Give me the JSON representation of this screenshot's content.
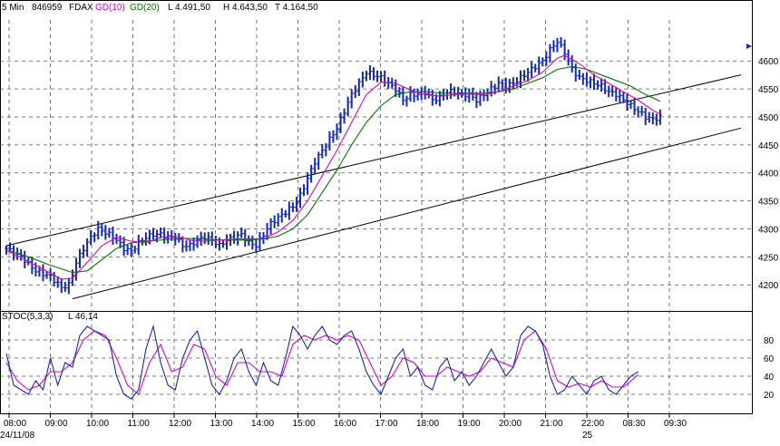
{
  "header": {
    "interval": "5 Min",
    "code": "846959",
    "symbol": "FDAX",
    "gd10_label": "GD(10)",
    "gd20_label": "GD(20)",
    "low_label": "L 4.491,50",
    "high_label": "H 4.643,50",
    "low2_label": "T 4.164,50"
  },
  "colors": {
    "candles": "#1428b4",
    "gd10": "#e000c8",
    "gd20": "#007800",
    "stoch_k": "#1428b4",
    "stoch_d": "#e000c8",
    "trend": "#000000",
    "grid": "#555555",
    "marker": "#1428b4"
  },
  "chart_data": [
    {
      "type": "candlestick",
      "title": "",
      "y_ticks": [
        "4200",
        "4250",
        "4300",
        "4350",
        "4400",
        "4450",
        "4500",
        "4550",
        "4600"
      ],
      "ylim": [
        4155,
        4670
      ],
      "x_ticks": [
        "08:00",
        "09:00",
        "10:00",
        "11:00",
        "12:00",
        "13:00",
        "14:00",
        "15:00",
        "16:00",
        "17:00",
        "18:00",
        "19:00",
        "20:00",
        "21:00",
        "22:00",
        "08:30",
        "09:30"
      ],
      "date_labels": [
        "24/11/08",
        "25"
      ],
      "price_path": [
        [
          0,
          4265
        ],
        [
          4,
          4250
        ],
        [
          8,
          4225
        ],
        [
          12,
          4215
        ],
        [
          15,
          4195
        ],
        [
          17,
          4200
        ],
        [
          19,
          4240
        ],
        [
          21,
          4265
        ],
        [
          23,
          4285
        ],
        [
          25,
          4300
        ],
        [
          28,
          4290
        ],
        [
          30,
          4280
        ],
        [
          32,
          4265
        ],
        [
          34,
          4260
        ],
        [
          36,
          4275
        ],
        [
          38,
          4285
        ],
        [
          40,
          4290
        ],
        [
          42,
          4290
        ],
        [
          44,
          4285
        ],
        [
          46,
          4285
        ],
        [
          48,
          4270
        ],
        [
          50,
          4270
        ],
        [
          52,
          4280
        ],
        [
          54,
          4285
        ],
        [
          56,
          4280
        ],
        [
          58,
          4270
        ],
        [
          60,
          4280
        ],
        [
          62,
          4285
        ],
        [
          64,
          4290
        ],
        [
          66,
          4275
        ],
        [
          68,
          4270
        ],
        [
          70,
          4290
        ],
        [
          72,
          4310
        ],
        [
          74,
          4320
        ],
        [
          76,
          4330
        ],
        [
          78,
          4340
        ],
        [
          80,
          4360
        ],
        [
          82,
          4390
        ],
        [
          84,
          4420
        ],
        [
          86,
          4440
        ],
        [
          88,
          4460
        ],
        [
          90,
          4480
        ],
        [
          92,
          4510
        ],
        [
          94,
          4540
        ],
        [
          96,
          4560
        ],
        [
          98,
          4580
        ],
        [
          100,
          4575
        ],
        [
          102,
          4570
        ],
        [
          104,
          4560
        ],
        [
          106,
          4550
        ],
        [
          108,
          4530
        ],
        [
          110,
          4540
        ],
        [
          112,
          4540
        ],
        [
          114,
          4545
        ],
        [
          116,
          4530
        ],
        [
          118,
          4535
        ],
        [
          120,
          4545
        ],
        [
          122,
          4545
        ],
        [
          124,
          4540
        ],
        [
          126,
          4540
        ],
        [
          128,
          4530
        ],
        [
          130,
          4540
        ],
        [
          132,
          4550
        ],
        [
          134,
          4560
        ],
        [
          136,
          4555
        ],
        [
          138,
          4560
        ],
        [
          140,
          4570
        ],
        [
          142,
          4580
        ],
        [
          144,
          4590
        ],
        [
          146,
          4600
        ],
        [
          148,
          4620
        ],
        [
          150,
          4635
        ],
        [
          152,
          4615
        ],
        [
          154,
          4585
        ],
        [
          156,
          4570
        ],
        [
          158,
          4565
        ],
        [
          160,
          4560
        ],
        [
          162,
          4555
        ],
        [
          164,
          4545
        ],
        [
          166,
          4540
        ],
        [
          168,
          4530
        ],
        [
          170,
          4520
        ],
        [
          172,
          4510
        ],
        [
          174,
          4500
        ],
        [
          176,
          4495
        ],
        [
          178,
          4500
        ]
      ],
      "gd10_path": [
        [
          0,
          4262
        ],
        [
          5,
          4245
        ],
        [
          10,
          4228
        ],
        [
          15,
          4210
        ],
        [
          18,
          4212
        ],
        [
          22,
          4240
        ],
        [
          26,
          4270
        ],
        [
          30,
          4285
        ],
        [
          34,
          4278
        ],
        [
          38,
          4275
        ],
        [
          42,
          4285
        ],
        [
          46,
          4287
        ],
        [
          50,
          4280
        ],
        [
          54,
          4278
        ],
        [
          58,
          4280
        ],
        [
          62,
          4282
        ],
        [
          66,
          4282
        ],
        [
          70,
          4282
        ],
        [
          74,
          4295
        ],
        [
          78,
          4315
        ],
        [
          82,
          4350
        ],
        [
          86,
          4395
        ],
        [
          90,
          4440
        ],
        [
          94,
          4490
        ],
        [
          98,
          4540
        ],
        [
          102,
          4562
        ],
        [
          106,
          4560
        ],
        [
          110,
          4548
        ],
        [
          114,
          4540
        ],
        [
          118,
          4537
        ],
        [
          122,
          4540
        ],
        [
          126,
          4541
        ],
        [
          130,
          4540
        ],
        [
          134,
          4545
        ],
        [
          138,
          4555
        ],
        [
          142,
          4565
        ],
        [
          146,
          4580
        ],
        [
          150,
          4605
        ],
        [
          152,
          4610
        ],
        [
          156,
          4595
        ],
        [
          160,
          4575
        ],
        [
          164,
          4560
        ],
        [
          168,
          4545
        ],
        [
          172,
          4530
        ],
        [
          176,
          4512
        ],
        [
          178,
          4505
        ]
      ],
      "gd20_path": [
        [
          0,
          4262
        ],
        [
          6,
          4250
        ],
        [
          12,
          4235
        ],
        [
          18,
          4222
        ],
        [
          22,
          4225
        ],
        [
          26,
          4245
        ],
        [
          30,
          4265
        ],
        [
          34,
          4275
        ],
        [
          38,
          4278
        ],
        [
          42,
          4280
        ],
        [
          46,
          4283
        ],
        [
          50,
          4283
        ],
        [
          54,
          4282
        ],
        [
          58,
          4280
        ],
        [
          62,
          4280
        ],
        [
          66,
          4280
        ],
        [
          70,
          4282
        ],
        [
          74,
          4287
        ],
        [
          78,
          4300
        ],
        [
          82,
          4325
        ],
        [
          86,
          4365
        ],
        [
          90,
          4405
        ],
        [
          94,
          4450
        ],
        [
          98,
          4490
        ],
        [
          102,
          4520
        ],
        [
          106,
          4540
        ],
        [
          110,
          4545
        ],
        [
          114,
          4545
        ],
        [
          118,
          4543
        ],
        [
          122,
          4542
        ],
        [
          126,
          4542
        ],
        [
          130,
          4542
        ],
        [
          134,
          4545
        ],
        [
          138,
          4550
        ],
        [
          142,
          4560
        ],
        [
          146,
          4570
        ],
        [
          150,
          4585
        ],
        [
          154,
          4590
        ],
        [
          158,
          4585
        ],
        [
          162,
          4575
        ],
        [
          166,
          4565
        ],
        [
          170,
          4555
        ],
        [
          174,
          4540
        ],
        [
          178,
          4528
        ]
      ],
      "trend_lines": [
        {
          "from": [
            0,
            4270
          ],
          "to": [
            200,
            4575
          ]
        },
        {
          "from": [
            18,
            4175
          ],
          "to": [
            200,
            4480
          ]
        }
      ]
    },
    {
      "type": "line",
      "title": "",
      "series_labels": [
        "STOC(5,3,3)",
        "L 46,14"
      ],
      "y_ticks": [
        "20",
        "40",
        "60",
        "80"
      ],
      "ylim": [
        0,
        100
      ],
      "k_path": [
        [
          0,
          65
        ],
        [
          2,
          30
        ],
        [
          4,
          25
        ],
        [
          6,
          20
        ],
        [
          8,
          35
        ],
        [
          10,
          25
        ],
        [
          12,
          60
        ],
        [
          14,
          30
        ],
        [
          16,
          55
        ],
        [
          18,
          50
        ],
        [
          20,
          85
        ],
        [
          22,
          95
        ],
        [
          24,
          90
        ],
        [
          26,
          85
        ],
        [
          28,
          80
        ],
        [
          30,
          40
        ],
        [
          32,
          20
        ],
        [
          34,
          15
        ],
        [
          36,
          25
        ],
        [
          38,
          70
        ],
        [
          40,
          95
        ],
        [
          42,
          55
        ],
        [
          44,
          30
        ],
        [
          46,
          25
        ],
        [
          48,
          60
        ],
        [
          50,
          80
        ],
        [
          52,
          90
        ],
        [
          54,
          60
        ],
        [
          56,
          30
        ],
        [
          58,
          20
        ],
        [
          60,
          35
        ],
        [
          62,
          60
        ],
        [
          64,
          70
        ],
        [
          66,
          45
        ],
        [
          68,
          30
        ],
        [
          70,
          55
        ],
        [
          72,
          35
        ],
        [
          74,
          30
        ],
        [
          76,
          60
        ],
        [
          78,
          95
        ],
        [
          80,
          85
        ],
        [
          82,
          70
        ],
        [
          84,
          85
        ],
        [
          86,
          95
        ],
        [
          88,
          80
        ],
        [
          90,
          75
        ],
        [
          92,
          85
        ],
        [
          94,
          90
        ],
        [
          96,
          70
        ],
        [
          98,
          45
        ],
        [
          100,
          30
        ],
        [
          102,
          20
        ],
        [
          104,
          40
        ],
        [
          106,
          60
        ],
        [
          108,
          70
        ],
        [
          110,
          40
        ],
        [
          112,
          50
        ],
        [
          114,
          30
        ],
        [
          116,
          25
        ],
        [
          118,
          50
        ],
        [
          120,
          60
        ],
        [
          122,
          35
        ],
        [
          124,
          45
        ],
        [
          126,
          30
        ],
        [
          128,
          40
        ],
        [
          130,
          55
        ],
        [
          132,
          70
        ],
        [
          134,
          55
        ],
        [
          136,
          40
        ],
        [
          138,
          50
        ],
        [
          140,
          85
        ],
        [
          142,
          95
        ],
        [
          144,
          90
        ],
        [
          146,
          75
        ],
        [
          148,
          40
        ],
        [
          150,
          20
        ],
        [
          152,
          25
        ],
        [
          154,
          40
        ],
        [
          156,
          30
        ],
        [
          158,
          20
        ],
        [
          160,
          35
        ],
        [
          162,
          40
        ],
        [
          164,
          25
        ],
        [
          166,
          20
        ],
        [
          168,
          30
        ],
        [
          170,
          40
        ],
        [
          172,
          45
        ]
      ],
      "d_path": [
        [
          0,
          55
        ],
        [
          3,
          35
        ],
        [
          6,
          25
        ],
        [
          9,
          30
        ],
        [
          12,
          45
        ],
        [
          15,
          45
        ],
        [
          18,
          55
        ],
        [
          21,
          80
        ],
        [
          24,
          90
        ],
        [
          27,
          85
        ],
        [
          30,
          60
        ],
        [
          33,
          30
        ],
        [
          36,
          20
        ],
        [
          39,
          55
        ],
        [
          42,
          75
        ],
        [
          45,
          45
        ],
        [
          48,
          50
        ],
        [
          51,
          75
        ],
        [
          54,
          70
        ],
        [
          57,
          40
        ],
        [
          60,
          30
        ],
        [
          63,
          55
        ],
        [
          66,
          55
        ],
        [
          69,
          45
        ],
        [
          72,
          45
        ],
        [
          75,
          40
        ],
        [
          78,
          75
        ],
        [
          81,
          85
        ],
        [
          84,
          80
        ],
        [
          87,
          85
        ],
        [
          90,
          80
        ],
        [
          93,
          85
        ],
        [
          96,
          80
        ],
        [
          99,
          55
        ],
        [
          102,
          30
        ],
        [
          105,
          40
        ],
        [
          108,
          60
        ],
        [
          111,
          55
        ],
        [
          114,
          40
        ],
        [
          117,
          40
        ],
        [
          120,
          50
        ],
        [
          123,
          45
        ],
        [
          126,
          40
        ],
        [
          129,
          45
        ],
        [
          132,
          60
        ],
        [
          135,
          55
        ],
        [
          138,
          50
        ],
        [
          141,
          80
        ],
        [
          144,
          90
        ],
        [
          147,
          70
        ],
        [
          150,
          35
        ],
        [
          153,
          28
        ],
        [
          156,
          32
        ],
        [
          159,
          28
        ],
        [
          162,
          35
        ],
        [
          165,
          28
        ],
        [
          168,
          28
        ],
        [
          171,
          38
        ],
        [
          172,
          42
        ]
      ]
    }
  ]
}
